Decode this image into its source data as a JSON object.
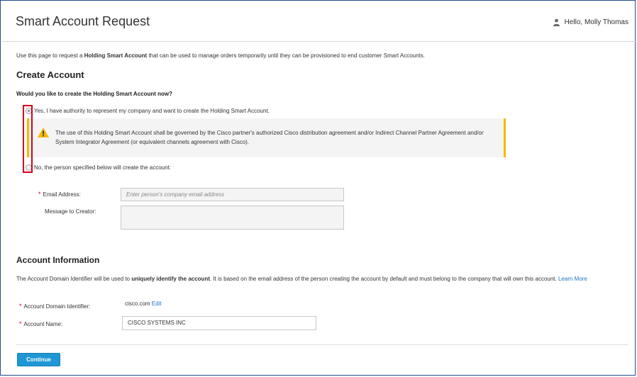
{
  "header": {
    "title": "Smart Account Request",
    "user_greeting": "Hello, Molly Thomas"
  },
  "intro": {
    "text_before": "Use this page to request a ",
    "text_bold": "Holding Smart Account",
    "text_after": " that can be used to manage orders temporarily until they can be provisioned to end customer Smart Accounts."
  },
  "create_account": {
    "heading": "Create Account",
    "question": "Would you like to create the Holding Smart Account now?",
    "option_yes": "Yes, I have authority to represent my company and want to create the Holding Smart Account.",
    "option_no": "No, the person specified below will create the account:",
    "selected": "yes",
    "warning_text": "The use of this Holding Smart Account shall be governed by the Cisco partner's authorized Cisco distribution agreement and/or Indirect Channel Partner Agreement and/or System Integrator Agreement (or equivalent channels agreement with Cisco).",
    "email_label": "Email Address:",
    "email_placeholder": "Enter person's company email address",
    "message_label": "Message to Creator:"
  },
  "account_info": {
    "heading": "Account Information",
    "desc_before": "The Account Domain Identifier will be used to ",
    "desc_bold": "uniquely identify the account",
    "desc_after": ". It is based on the email address of the person creating the account by default and must belong to the company that will own this account. ",
    "learn_more": "Learn More",
    "domain_label": "Account Domain Identifier:",
    "domain_value": "cisco.com",
    "edit_link": "Edit",
    "name_label": "Account Name:",
    "name_value": "CISCO SYSTEMS INC"
  },
  "actions": {
    "continue_label": "Continue"
  },
  "colors": {
    "accent": "#1f97d4",
    "warning": "#f5b800",
    "required": "#d0021b",
    "link": "#1a73c8"
  }
}
